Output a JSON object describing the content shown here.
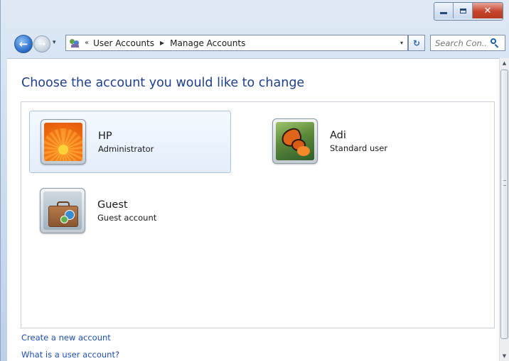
{
  "window": {
    "controls": {
      "minimize": "minimize",
      "maximize": "maximize",
      "close": "✕"
    }
  },
  "navbar": {
    "back_glyph": "←",
    "forward_glyph": "→",
    "history_glyph": "▾",
    "address": {
      "overflow": "«",
      "crumbs": [
        "User Accounts",
        "Manage Accounts"
      ],
      "separator": "▶",
      "dropdown": "▾"
    },
    "refresh_glyph": "↻",
    "search": {
      "placeholder": "Search Con..."
    }
  },
  "page": {
    "title": "Choose the account you would like to change",
    "accounts": [
      {
        "name": "HP",
        "type": "Administrator",
        "picture": "flower",
        "selected": true
      },
      {
        "name": "Adi",
        "type": "Standard user",
        "picture": "butterfly",
        "selected": false
      },
      {
        "name": "Guest",
        "type": "Guest account",
        "picture": "briefcase",
        "selected": false
      }
    ],
    "links": {
      "create": "Create a new account",
      "what_is": "What is a user account?"
    }
  },
  "scrollbar": {
    "up": "▲",
    "down": "▼"
  },
  "colors": {
    "title": "#1e3f8f",
    "link": "#1f50b3",
    "selection": "#e3eefb",
    "close_button": "#c8442c"
  }
}
